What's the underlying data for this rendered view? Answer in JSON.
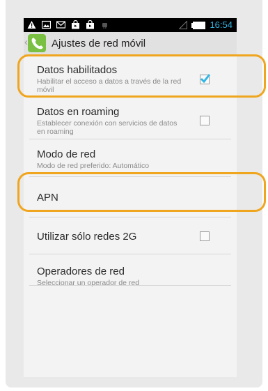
{
  "status_bar": {
    "time": "16:54",
    "icons": [
      "warning-icon",
      "image-icon",
      "mail-icon",
      "bag-icon",
      "bag-icon",
      "android-icon"
    ]
  },
  "action_bar": {
    "title": "Ajustes de red móvil",
    "app_icon": "phone-icon"
  },
  "settings": [
    {
      "title": "Datos habilitados",
      "summary": "Habilitar el acceso a datos a través de la red móvil",
      "checkbox": true,
      "checked": true
    },
    {
      "title": "Datos en roaming",
      "summary": "Establecer conexión con servicios de datos en roaming",
      "checkbox": true,
      "checked": false
    },
    {
      "title": "Modo de red",
      "summary": "Modo de red preferido: Automático",
      "checkbox": false
    },
    {
      "title": "APN",
      "summary": "",
      "checkbox": false
    },
    {
      "title": "Utilizar sólo redes 2G",
      "summary": "",
      "checkbox": true,
      "checked": false
    },
    {
      "title": "Operadores de red",
      "summary": "Seleccionar un operador de red",
      "checkbox": false
    }
  ],
  "colors": {
    "accent": "#33b5e5",
    "highlight": "#f0a51e",
    "app_icon": "#7ac143"
  }
}
